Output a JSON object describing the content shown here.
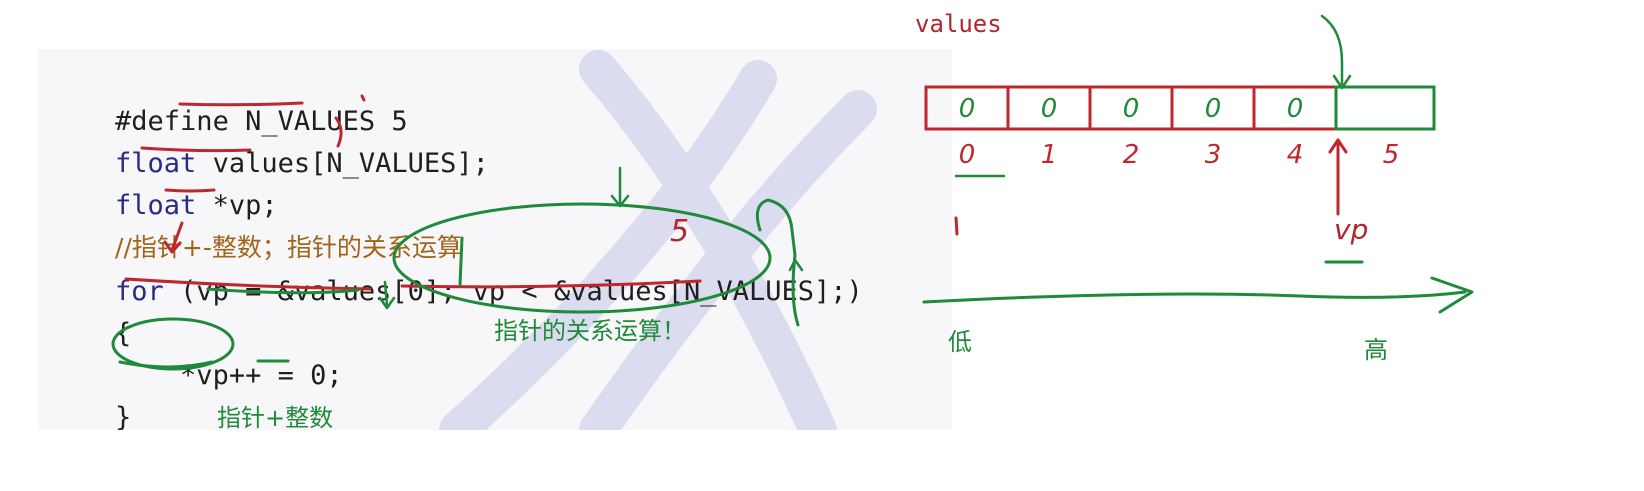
{
  "code": {
    "line1_kw": "#define",
    "line1_rest": " N_VALUES 5",
    "line2_kw": "float",
    "line2_rest": " values[N_VALUES];",
    "line3_kw": "float",
    "line3_rest": " *vp;",
    "line4_comment": "//指针+-整数；指针的关系运算",
    "line5_kw": "for",
    "line5_rest": " (vp = &values[0]; vp < &values[N_VALUES];)",
    "line6": "{",
    "line7": "    *vp++ = 0;",
    "line8": "}"
  },
  "annotations": {
    "relation_op": "指针的关系运算！",
    "pointer_plus_int": "指针+整数",
    "array_name": "values",
    "low": "低",
    "high": "高",
    "vp_label": "vp",
    "red_five": "5"
  },
  "array": {
    "cells": [
      "0",
      "0",
      "0",
      "0",
      "0",
      ""
    ],
    "indices": [
      "0",
      "1",
      "2",
      "3",
      "4",
      "5"
    ]
  },
  "colors": {
    "ink_green": "#1f8a3a",
    "ink_red": "#c0262e",
    "cell_border_red": "#c0262e",
    "cell_border_green": "#1f8a3a"
  }
}
